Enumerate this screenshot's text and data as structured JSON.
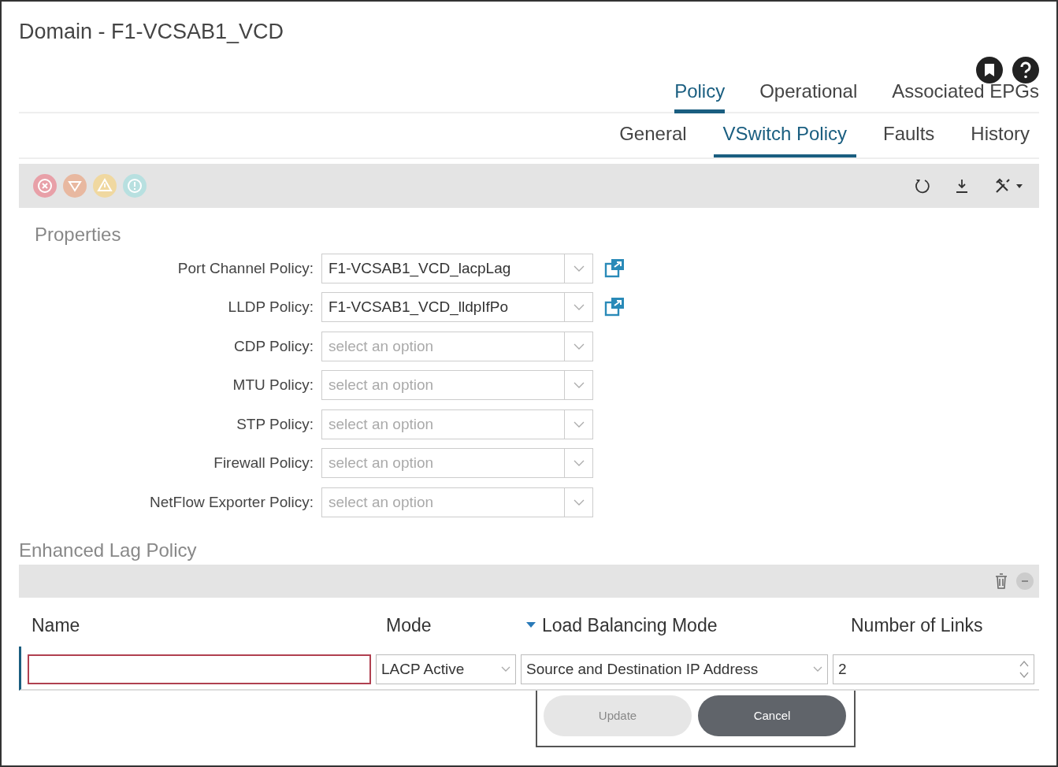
{
  "window": {
    "title": "Domain - F1-VCSAB1_VCD"
  },
  "tabs": [
    {
      "label": "Policy",
      "selected": true
    },
    {
      "label": "Operational",
      "selected": false
    },
    {
      "label": "Associated EPGs",
      "selected": false
    }
  ],
  "subtabs": [
    {
      "label": "General",
      "selected": false
    },
    {
      "label": "VSwitch Policy",
      "selected": true
    },
    {
      "label": "Faults",
      "selected": false
    },
    {
      "label": "History",
      "selected": false
    }
  ],
  "fault_counters": [
    {
      "kind": "critical",
      "color": "#e8a0a8"
    },
    {
      "kind": "major",
      "color": "#e8b8a0"
    },
    {
      "kind": "minor",
      "color": "#f0d8a0"
    },
    {
      "kind": "warning",
      "color": "#b8e0e0"
    }
  ],
  "properties": {
    "title": "Properties",
    "fields": [
      {
        "label": "Port Channel Policy:",
        "value": "F1-VCSAB1_VCD_lacpLag",
        "link_icon": true
      },
      {
        "label": "LLDP Policy:",
        "value": "F1-VCSAB1_VCD_lldpIfPo",
        "link_icon": true
      },
      {
        "label": "CDP Policy:",
        "placeholder": "select an option",
        "link_icon": false
      },
      {
        "label": "MTU Policy:",
        "placeholder": "select an option",
        "link_icon": false
      },
      {
        "label": "STP Policy:",
        "placeholder": "select an option",
        "link_icon": false
      },
      {
        "label": "Firewall Policy:",
        "placeholder": "select an option",
        "link_icon": false
      },
      {
        "label": "NetFlow Exporter Policy:",
        "placeholder": "select an option",
        "link_icon": false
      }
    ]
  },
  "enhanced_lag": {
    "title": "Enhanced Lag Policy",
    "columns": [
      {
        "label": "Name",
        "sorted": false
      },
      {
        "label": "Mode",
        "sorted": false
      },
      {
        "label": "Load Balancing Mode",
        "sorted": true
      },
      {
        "label": "Number of Links",
        "sorted": false
      }
    ],
    "edit_row": {
      "name": {
        "invalid": true
      },
      "mode": "LACP Active",
      "load_balancing": "Source and Destination IP Address",
      "links": "2"
    },
    "buttons": [
      {
        "label": "Update",
        "disabled": true
      },
      {
        "label": "Cancel",
        "disabled": false
      }
    ]
  }
}
